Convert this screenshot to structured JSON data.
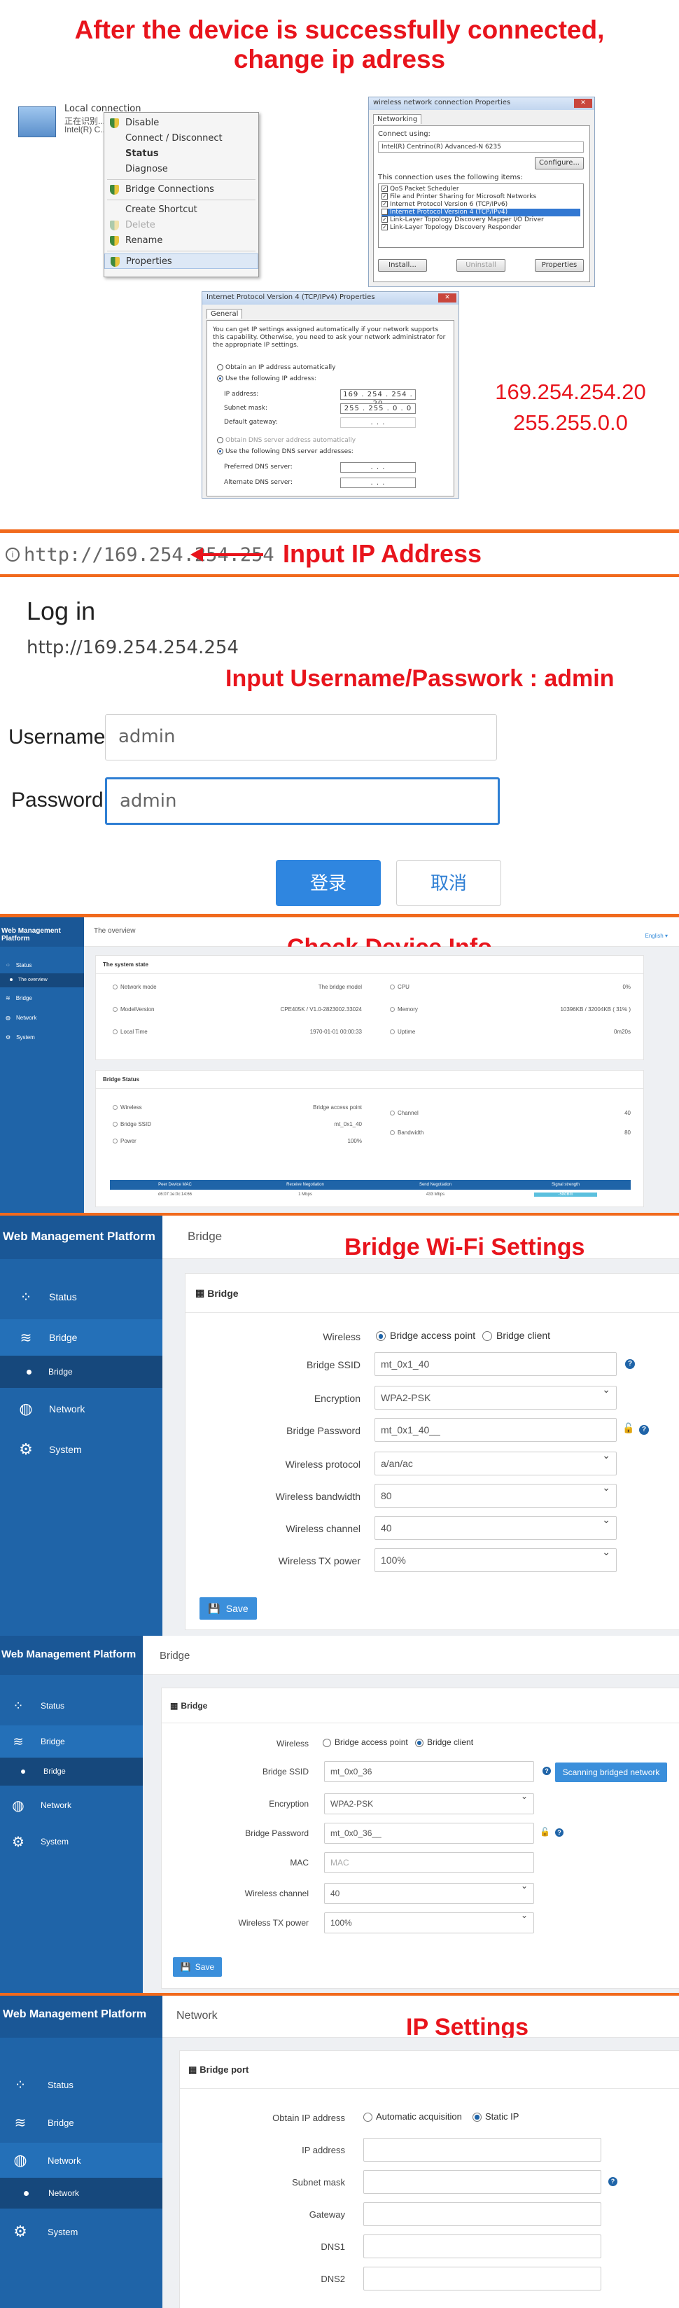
{
  "section1": {
    "title": "After the device is successfully connected,",
    "title2": "change ip adress",
    "adapter": {
      "name": "Local connection",
      "line2": "正在识别...",
      "line3": "Intel(R) C..."
    },
    "context_menu": [
      "Disable",
      "Connect / Disconnect",
      "Status",
      "Diagnose",
      "Bridge Connections",
      "Create Shortcut",
      "Delete",
      "Rename",
      "Properties"
    ],
    "props": {
      "title": "wireless network connection Properties",
      "tab": "Networking",
      "connect_using": "Connect using:",
      "adapter": "Intel(R) Centrino(R) Advanced-N 6235",
      "configure": "Configure...",
      "items_label": "This connection uses the following items:",
      "items": [
        "QoS Packet Scheduler",
        "File and Printer Sharing for Microsoft Networks",
        "Internet Protocol Version 6 (TCP/IPv6)",
        "Internet Protocol Version 4 (TCP/IPv4)",
        "Link-Layer Topology Discovery Mapper I/O Driver",
        "Link-Layer Topology Discovery Responder"
      ],
      "install": "Install...",
      "uninstall": "Uninstall",
      "properties": "Properties"
    },
    "ipv4": {
      "title": "Internet Protocol Version 4 (TCP/IPv4) Properties",
      "tab": "General",
      "desc": "You can get IP settings assigned automatically if your network supports this capability. Otherwise, you need to ask your network administrator for the appropriate IP settings.",
      "auto": "Obtain an IP address automatically",
      "use": "Use the following IP address:",
      "ip_label": "IP address:",
      "ip_value": "169 . 254 . 254 . 20",
      "mask_label": "Subnet mask:",
      "mask_value": "255 . 255 . 0 . 0",
      "gw_label": "Default gateway:",
      "gw_value": ". . .",
      "dns_auto": "Obtain DNS server address automatically",
      "dns_use": "Use the following DNS server addresses:",
      "pdns": "Preferred DNS server:",
      "adns": "Alternate DNS server:"
    },
    "ip_note": "169.254.254.20",
    "mask_note": "255.255.0.0"
  },
  "section2": {
    "url": "http://169.254.254.254",
    "label": "Input IP Address"
  },
  "section3": {
    "title": "Log in",
    "url": "http://169.254.254.254",
    "hint": "Input Username/Passwork : admin",
    "username_label": "Username",
    "username_value": "admin",
    "password_label": "Password",
    "password_value": "admin",
    "login": "登录",
    "cancel": "取消"
  },
  "overview": {
    "label": "Check Device Info.",
    "platform": "Web Management Platform",
    "page": "The overview",
    "lang": "English ▾",
    "nav": [
      "Status",
      "The overview",
      "Bridge",
      "Network",
      "System"
    ],
    "system_state": "The system state",
    "rows_left": [
      [
        "Network mode",
        "The bridge model"
      ],
      [
        "ModelVersion",
        "CPE405K / V1.0-2823002.33024"
      ],
      [
        "Local Time",
        "1970-01-01 00:00:33"
      ]
    ],
    "rows_right": [
      [
        "CPU",
        "0%"
      ],
      [
        "Memory",
        "10396KB / 32004KB ( 31% )"
      ],
      [
        "Uptime",
        "0m20s"
      ]
    ],
    "bridge_status": "Bridge Status",
    "b_left": [
      [
        "Wireless",
        "Bridge access point"
      ],
      [
        "Bridge SSID",
        "mt_0x1_40"
      ],
      [
        "Power",
        "100%"
      ]
    ],
    "b_right": [
      [
        "Channel",
        "40"
      ],
      [
        "Bandwidth",
        "80"
      ]
    ],
    "table_headers": [
      "Peer Device MAC",
      "Receive Negotiation",
      "Send Negotiation",
      "Signal strength"
    ],
    "table_row": [
      "d6:07:1e:0c:14:66",
      "1 Mbps",
      "433 Mbps",
      "-58dBm"
    ]
  },
  "bridge_ap": {
    "label": "Bridge Wi-Fi Settings",
    "platform": "Web Management Platform",
    "page": "Bridge",
    "nav": [
      "Status",
      "Bridge",
      "Bridge",
      "Network",
      "System"
    ],
    "panel": "Bridge",
    "wireless_label": "Wireless",
    "opt_ap": "Bridge access point",
    "opt_client": "Bridge client",
    "ssid_label": "Bridge SSID",
    "ssid": "mt_0x1_40",
    "enc_label": "Encryption",
    "enc": "WPA2-PSK",
    "pwd_label": "Bridge Password",
    "pwd": "mt_0x1_40__",
    "proto_label": "Wireless protocol",
    "proto": "a/an/ac",
    "bw_label": "Wireless bandwidth",
    "bw": "80",
    "ch_label": "Wireless channel",
    "ch": "40",
    "tx_label": "Wireless TX power",
    "tx": "100%",
    "save": "Save"
  },
  "bridge_client": {
    "platform": "Web Management Platform",
    "page": "Bridge",
    "nav": [
      "Status",
      "Bridge",
      "Bridge",
      "Network",
      "System"
    ],
    "panel": "Bridge",
    "wireless_label": "Wireless",
    "opt_ap": "Bridge access point",
    "opt_client": "Bridge client",
    "ssid_label": "Bridge SSID",
    "ssid": "mt_0x0_36",
    "scan": "Scanning bridged network",
    "enc_label": "Encryption",
    "enc": "WPA2-PSK",
    "pwd_label": "Bridge Password",
    "pwd": "mt_0x0_36__",
    "mac_label": "MAC",
    "mac": "MAC",
    "ch_label": "Wireless channel",
    "ch": "40",
    "tx_label": "Wireless TX power",
    "tx": "100%",
    "save": "Save"
  },
  "network": {
    "label": "IP Settings",
    "platform": "Web Management Platform",
    "page": "Network",
    "nav": [
      "Status",
      "Bridge",
      "Network",
      "Network",
      "System"
    ],
    "panel": "Bridge port",
    "obtain_label": "Obtain IP address",
    "opt_auto": "Automatic acquisition",
    "opt_static": "Static IP",
    "ip_label": "IP address",
    "mask_label": "Subnet mask",
    "gw_label": "Gateway",
    "dns1_label": "DNS1",
    "dns2_label": "DNS2"
  },
  "colors": {
    "red": "#e8141c",
    "orange": "#f16a1d",
    "sidebar": "#1f64a8",
    "button": "#3b8fdb"
  }
}
